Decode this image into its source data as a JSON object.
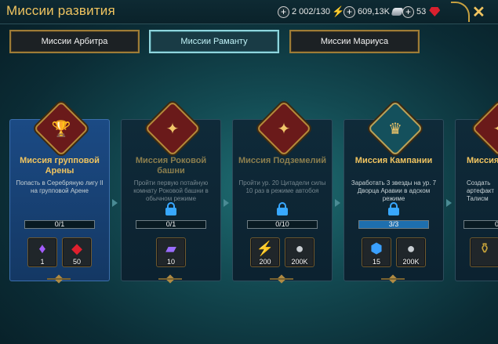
{
  "header": {
    "title": "Миссии развития",
    "energy": "2 002/130",
    "silver": "609,13K",
    "gems": "53"
  },
  "tabs": [
    {
      "label": "Миссии Арбитра",
      "active": false
    },
    {
      "label": "Миссии Раманту",
      "active": true
    },
    {
      "label": "Миссии Мариуса",
      "active": false
    }
  ],
  "cards": [
    {
      "title": "Миссия групповой Арены",
      "desc": "Попасть в Серебряную лигу II на групповой Арене",
      "progress": "0/1",
      "emblem": "trophy-icon",
      "rewards": [
        {
          "icon": "artifact-icon",
          "count": "1"
        },
        {
          "icon": "ruby-icon",
          "count": "50"
        }
      ]
    },
    {
      "title": "Миссия Роковой башни",
      "desc": "Пройти первую потайную комнату Роковой башни в обычном режиме",
      "progress": "0/1",
      "emblem": "hellhound-icon",
      "rewards": [
        {
          "icon": "scroll-icon",
          "count": "10"
        }
      ]
    },
    {
      "title": "Миссия Подземелий",
      "desc": "Пройти ур. 20 Цитадели силы 10 раз в режиме автобоя",
      "progress": "0/10",
      "emblem": "hellhound-icon",
      "rewards": [
        {
          "icon": "energy-icon",
          "count": "200"
        },
        {
          "icon": "silver-coin-icon",
          "count": "200K"
        }
      ]
    },
    {
      "title": "Миссия Кампании",
      "desc": "Заработать 3 звезды на ур. 7 Дворца Аравии в адском режиме",
      "progress": "3/3",
      "emblem": "crown-icon",
      "rewards": [
        {
          "icon": "shield-icon",
          "count": "15"
        },
        {
          "icon": "silver-coin-icon",
          "count": "200K"
        }
      ]
    },
    {
      "title": "Миссия",
      "desc": "Создать артефакт Талисм",
      "progress": "0",
      "emblem": "hellhound-icon",
      "rewards": [
        {
          "icon": "potion-icon",
          "count": ""
        }
      ]
    }
  ],
  "colors": {
    "gold": "#f0c460",
    "accent": "#8fd4dc",
    "lock": "#38a8ff"
  }
}
